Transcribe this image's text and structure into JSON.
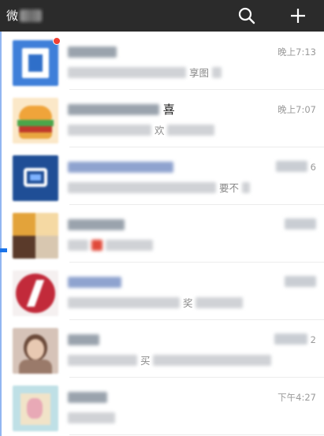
{
  "header": {
    "title": "微",
    "icons": {
      "search": "search-icon",
      "add": "plus-icon"
    }
  },
  "colors": {
    "header_bg": "#2b2b2b",
    "unread_dot": "#f04134",
    "link_blue": "#576b95"
  },
  "chats": [
    {
      "name_tail": "",
      "preview_tail": "享图",
      "time": "晚上7:13",
      "unread": true
    },
    {
      "name_tail": "喜",
      "preview_tail": "欢",
      "time": "晚上7:07",
      "unread": false
    },
    {
      "name_tail": "",
      "preview_tail": "要不",
      "time": "6",
      "unread": false
    },
    {
      "name_tail": "",
      "preview_tail": "",
      "time": "",
      "unread": false
    },
    {
      "name_tail": "",
      "preview_tail": "奖",
      "time": "",
      "unread": false
    },
    {
      "name_tail": "",
      "preview_tail": "买",
      "time": "2",
      "unread": false
    },
    {
      "name_tail": "",
      "preview_tail": "",
      "time": "下午4:27",
      "unread": false
    }
  ]
}
